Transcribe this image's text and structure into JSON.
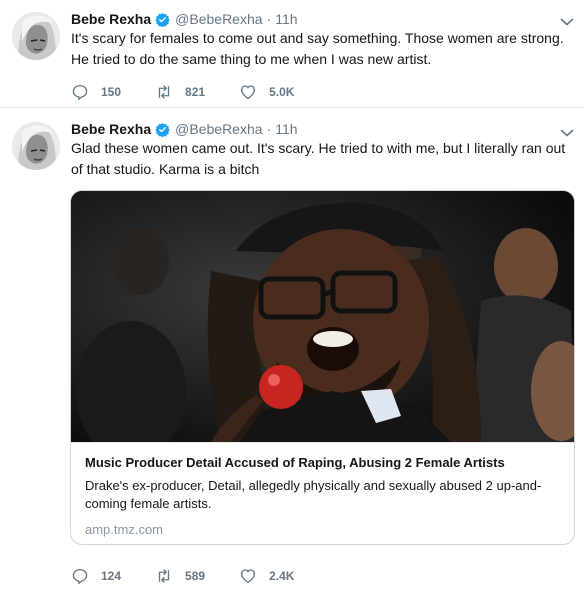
{
  "colors": {
    "verified_blue": "#1da1f2",
    "secondary_text": "#657786",
    "divider": "#e6ecf0"
  },
  "tweets": [
    {
      "name": "Bebe Rexha",
      "handle": "@BebeRexha",
      "separator": "·",
      "time": "11h",
      "text": "It's scary for females to come out and say something. Those women are strong. He tried to do the same thing to me when I was new artist.",
      "replies": "150",
      "retweets": "821",
      "likes": "5.0K",
      "icons": [
        "verified-badge-icon",
        "chevron-down-icon",
        "reply-icon",
        "retweet-icon",
        "heart-icon"
      ]
    },
    {
      "name": "Bebe Rexha",
      "handle": "@BebeRexha",
      "separator": "·",
      "time": "11h",
      "text": "Glad these women came out. It's scary. He tried to with me, but I literally ran out of that studio. Karma is a bitch",
      "card": {
        "title": "Music Producer Detail Accused of Raping, Abusing 2 Female Artists",
        "description": "Drake's ex-producer, Detail, allegedly physically and sexually abused 2 up-and-coming female artists.",
        "domain": "amp.tmz.com"
      },
      "replies": "124",
      "retweets": "589",
      "likes": "2.4K",
      "icons": [
        "verified-badge-icon",
        "chevron-down-icon",
        "reply-icon",
        "retweet-icon",
        "heart-icon"
      ]
    }
  ]
}
